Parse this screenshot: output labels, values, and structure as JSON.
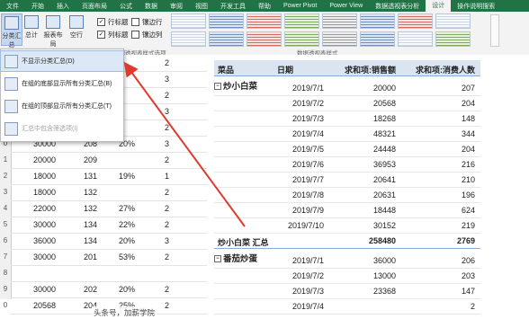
{
  "tabs": [
    "文件",
    "开始",
    "插入",
    "页面布局",
    "公式",
    "数据",
    "审阅",
    "视图",
    "开发工具",
    "帮助",
    "Power Pivot",
    "Power View",
    "数据透视表分析",
    "设计",
    "操作说明搜索"
  ],
  "ribbon": {
    "buttons": [
      "分类汇总",
      "总计",
      "报表布局",
      "空行"
    ],
    "checks": [
      {
        "label": "行标题",
        "checked": true
      },
      {
        "label": "镶边行",
        "checked": false
      },
      {
        "label": "列标题",
        "checked": true
      },
      {
        "label": "镶边列",
        "checked": false
      }
    ],
    "group_labels": {
      "options": "数据透视表样式选项",
      "styles": "数据透视表样式"
    }
  },
  "menu": {
    "items": [
      {
        "label": "不显示分类汇总(D)",
        "highlighted": true,
        "disabled": false
      },
      {
        "label": "在组的底部显示所有分类汇总(B)",
        "highlighted": false,
        "disabled": false
      },
      {
        "label": "在组的顶部显示所有分类汇总(T)",
        "highlighted": false,
        "disabled": false
      },
      {
        "label": "汇总中包含筛选项(I)",
        "highlighted": false,
        "disabled": true
      }
    ]
  },
  "left_rows": [
    {
      "n": "",
      "a": "",
      "b": "",
      "c": "",
      "d": "2"
    },
    {
      "n": "",
      "a": "",
      "b": "",
      "c": "",
      "d": "3"
    },
    {
      "n": "",
      "a": "",
      "b": "",
      "c": "",
      "d": "2"
    },
    {
      "n": "",
      "a": "",
      "b": "",
      "c": "",
      "d": "3"
    },
    {
      "n": "",
      "a": "",
      "b": "",
      "c": "",
      "d": "2"
    },
    {
      "n": "0",
      "a": "30000",
      "b": "208",
      "c": "20%",
      "d": "3"
    },
    {
      "n": "1",
      "a": "20000",
      "b": "209",
      "c": "",
      "d": "2"
    },
    {
      "n": "2",
      "a": "18000",
      "b": "131",
      "c": "19%",
      "d": "1"
    },
    {
      "n": "3",
      "a": "18000",
      "b": "132",
      "c": "",
      "d": "2"
    },
    {
      "n": "4",
      "a": "22000",
      "b": "132",
      "c": "27%",
      "d": "2"
    },
    {
      "n": "5",
      "a": "30000",
      "b": "134",
      "c": "22%",
      "d": "2"
    },
    {
      "n": "6",
      "a": "36000",
      "b": "134",
      "c": "20%",
      "d": "3"
    },
    {
      "n": "7",
      "a": "30000",
      "b": "201",
      "c": "53%",
      "d": "2"
    },
    {
      "n": "8",
      "a": "",
      "b": "",
      "c": "",
      "d": ""
    },
    {
      "n": "9",
      "a": "30000",
      "b": "202",
      "c": "20%",
      "d": "2"
    },
    {
      "n": "0",
      "a": "20568",
      "b": "204",
      "c": "25%",
      "d": "2"
    }
  ],
  "pivot": {
    "headers": [
      "菜品",
      "日期",
      "求和项:销售额",
      "求和项:消费人数"
    ],
    "group1": "炒小白菜",
    "rows": [
      [
        "2019/7/1",
        "20000",
        "207"
      ],
      [
        "2019/7/2",
        "20568",
        "204"
      ],
      [
        "2019/7/3",
        "18268",
        "148"
      ],
      [
        "2019/7/4",
        "48321",
        "344"
      ],
      [
        "2019/7/5",
        "24448",
        "204"
      ],
      [
        "2019/7/6",
        "36953",
        "216"
      ],
      [
        "2019/7/7",
        "20641",
        "210"
      ],
      [
        "2019/7/8",
        "20631",
        "196"
      ],
      [
        "2019/7/9",
        "18448",
        "624"
      ],
      [
        "2019/7/10",
        "30152",
        "219"
      ]
    ],
    "subtotal": {
      "label": "炒小白菜 汇总",
      "sales": "258480",
      "people": "2769"
    },
    "group2": "番茄炒蛋",
    "rows2": [
      [
        "2019/7/1",
        "36000",
        "206"
      ],
      [
        "2019/7/2",
        "13000",
        "203"
      ],
      [
        "2019/7/3",
        "23368",
        "147"
      ],
      [
        "2019/7/4",
        "",
        "2"
      ]
    ]
  },
  "watermark": "头条号，加薪学院",
  "colors": {
    "excel_green": "#217346",
    "arrow": "#e03a2f"
  }
}
